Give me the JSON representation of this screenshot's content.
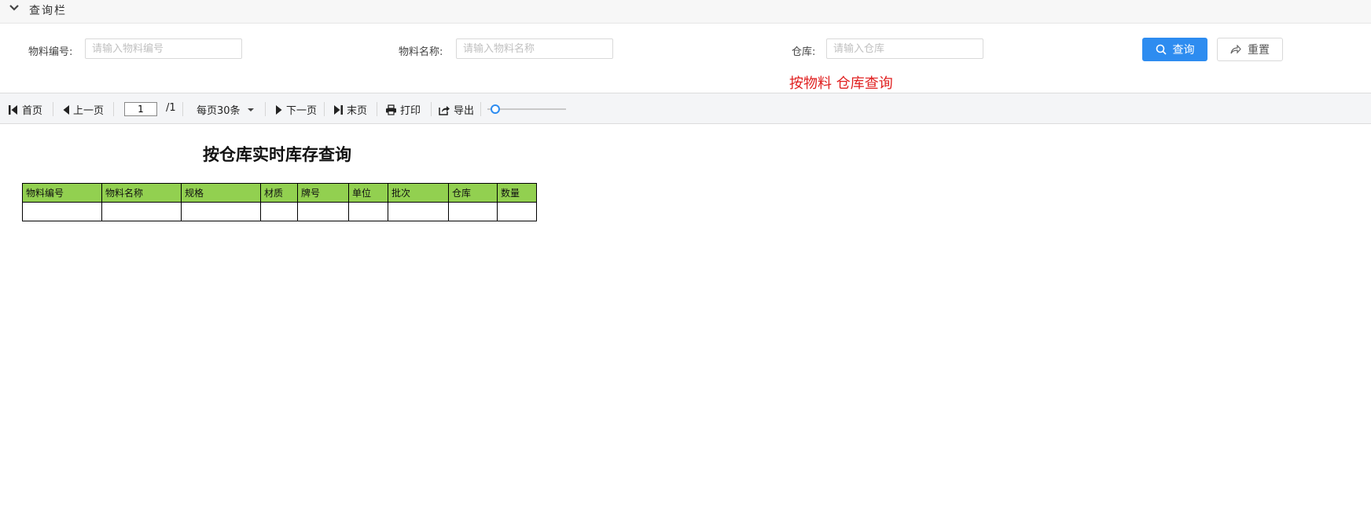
{
  "query_bar": {
    "title": "查询栏"
  },
  "form": {
    "material_code": {
      "label": "物料编号:",
      "placeholder": "请输入物料编号",
      "value": ""
    },
    "material_name": {
      "label": "物料名称:",
      "placeholder": "请输入物料名称",
      "value": ""
    },
    "warehouse": {
      "label": "仓库:",
      "placeholder": "请输入仓库",
      "value": ""
    },
    "search_label": "查询",
    "reset_label": "重置",
    "hint": "按物料 仓库查询"
  },
  "toolbar": {
    "first_label": "首页",
    "prev_label": "上一页",
    "page_value": "1",
    "page_total": "/1",
    "page_size_label": "每页30条",
    "next_label": "下一页",
    "last_label": "末页",
    "print_label": "打印",
    "export_label": "导出",
    "zoom_fraction": 0.1
  },
  "report": {
    "title": "按仓库实时库存查询",
    "columns": [
      "物料编号",
      "物料名称",
      "规格",
      "材质",
      "牌号",
      "单位",
      "批次",
      "仓库",
      "数量"
    ],
    "rows": [
      [
        "",
        "",
        "",
        "",
        "",
        "",
        "",
        "",
        ""
      ]
    ]
  },
  "colors": {
    "primary": "#2d8cf0",
    "header_bg": "#92d050",
    "hint": "#e02020"
  }
}
